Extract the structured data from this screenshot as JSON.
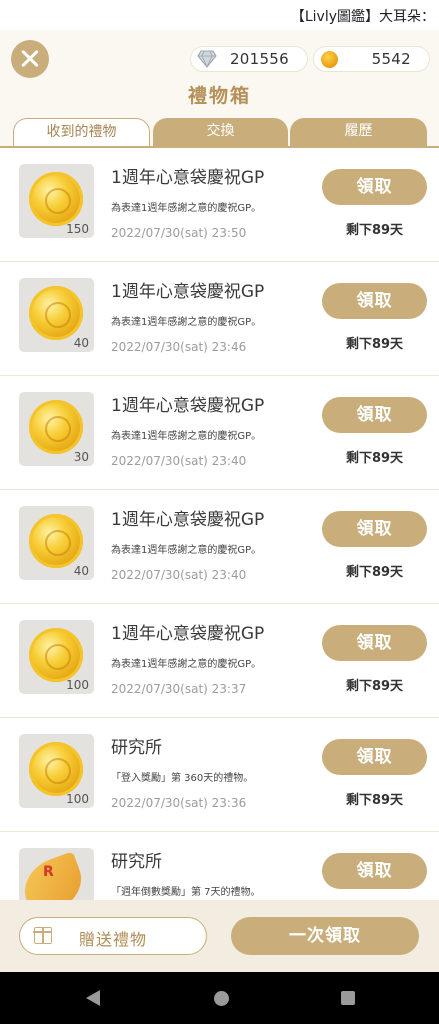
{
  "status_bar": {
    "text": "【Livly圖鑑】大耳朵："
  },
  "currency": {
    "diamonds": "201556",
    "coins": "5542"
  },
  "title": "禮物箱",
  "tabs": [
    {
      "label": "收到的禮物",
      "active": true
    },
    {
      "label": "交換",
      "active": false
    },
    {
      "label": "履歷",
      "active": false
    }
  ],
  "gifts": [
    {
      "title": "1週年心意袋慶祝GP",
      "desc": "為表達1週年感謝之意的慶祝GP。",
      "date": "2022/07/30(sat) 23:50",
      "qty": "150",
      "icon": "gold-coin-icon",
      "button": "領取",
      "remain": "剩下89天"
    },
    {
      "title": "1週年心意袋慶祝GP",
      "desc": "為表達1週年感謝之意的慶祝GP。",
      "date": "2022/07/30(sat) 23:46",
      "qty": "40",
      "icon": "gold-coin-icon",
      "button": "領取",
      "remain": "剩下89天"
    },
    {
      "title": "1週年心意袋慶祝GP",
      "desc": "為表達1週年感謝之意的慶祝GP。",
      "date": "2022/07/30(sat) 23:40",
      "qty": "30",
      "icon": "gold-coin-icon",
      "button": "領取",
      "remain": "剩下89天"
    },
    {
      "title": "1週年心意袋慶祝GP",
      "desc": "為表達1週年感謝之意的慶祝GP。",
      "date": "2022/07/30(sat) 23:40",
      "qty": "40",
      "icon": "gold-coin-icon",
      "button": "領取",
      "remain": "剩下89天"
    },
    {
      "title": "1週年心意袋慶祝GP",
      "desc": "為表達1週年感謝之意的慶祝GP。",
      "date": "2022/07/30(sat) 23:37",
      "qty": "100",
      "icon": "gold-coin-icon",
      "button": "領取",
      "remain": "剩下89天"
    },
    {
      "title": "研究所",
      "desc": "「登入獎勵」第 360天的禮物。",
      "date": "2022/07/30(sat) 23:36",
      "qty": "100",
      "icon": "gold-coin-icon",
      "button": "領取",
      "remain": "剩下89天"
    },
    {
      "title": "研究所",
      "desc": "「週年倒數獎勵」第 7天的禮物。",
      "date": "",
      "qty": "",
      "icon": "rare-leaf-icon",
      "leaf_label": "R",
      "button": "領取",
      "remain": ""
    }
  ],
  "footer": {
    "send_label": "贈送禮物",
    "claim_all_label": "一次領取"
  },
  "colors": {
    "accent": "#c9ae7c",
    "title": "#b59058",
    "background": "#fbf8f2"
  }
}
